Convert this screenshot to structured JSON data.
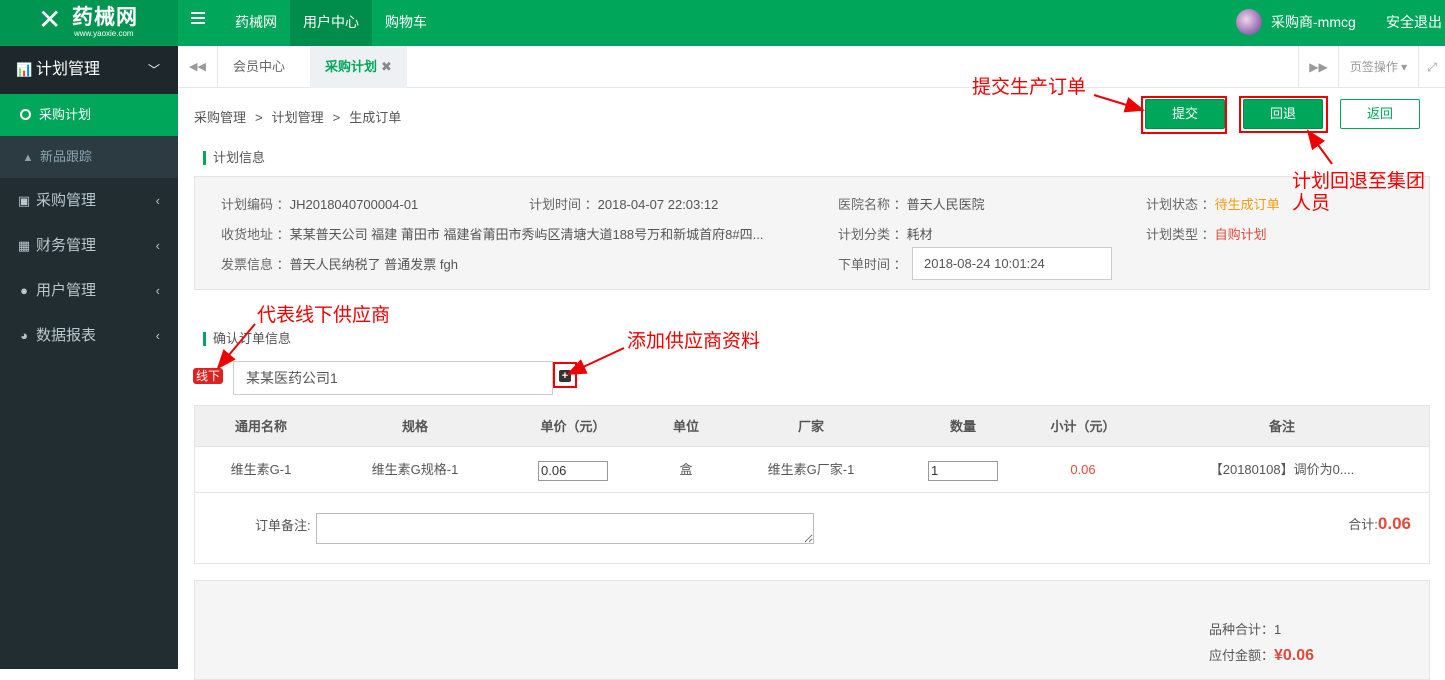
{
  "header": {
    "logo_mark": "✕",
    "logo_text": "药械网",
    "logo_url": "www.yaoxie.com",
    "nav": [
      "药械网",
      "用户中心",
      "购物车"
    ],
    "user_name": "采购商-mmcg",
    "logout": "安全退出"
  },
  "sidebar": {
    "group_title": "计划管理",
    "sub_items": [
      "采购计划",
      "新品跟踪"
    ],
    "items": [
      "采购管理",
      "财务管理",
      "用户管理",
      "数据报表"
    ]
  },
  "tabs": {
    "items": [
      "会员中心",
      "采购计划"
    ],
    "page_ops": "页签操作"
  },
  "breadcrumb": [
    "采购管理",
    "计划管理",
    "生成订单"
  ],
  "breadcrumb_sep": ">",
  "actions": {
    "submit": "提交",
    "rollback": "回退",
    "back": "返回"
  },
  "plan": {
    "section_title": "计划信息",
    "code_label": "计划编码 ：",
    "code": "JH2018040700004-01",
    "time_label": "计划时间 ：",
    "time": "2018-04-07 22:03:12",
    "hospital_label": "医院名称 ：",
    "hospital": "普天人民医院",
    "status_label": "计划状态 ：",
    "status": "待生成订单",
    "address_label": "收货地址 ：",
    "address": "某某普天公司 福建 莆田市 福建省莆田市秀屿区清塘大道188号万和新城首府8#四...",
    "category_label": "计划分类 ：",
    "category": "耗材",
    "type_label": "计划类型 ：",
    "type": "自购计划",
    "invoice_label": "发票信息 ：",
    "invoice": "普天人民纳税了 普通发票 fgh",
    "order_time_label": "下单时间 ：",
    "order_time": "2018-08-24 10:01:24"
  },
  "order": {
    "section_title": "确认订单信息",
    "offline_badge": "线下",
    "supplier": "某某医药公司1",
    "add_icon": "+",
    "headers": [
      "通用名称",
      "规格",
      "单价（元）",
      "单位",
      "厂家",
      "数量",
      "小计（元）",
      "备注"
    ],
    "rows": [
      {
        "name": "维生素G-1",
        "spec": "维生素G规格-1",
        "price": "0.06",
        "unit": "盒",
        "maker": "维生素G厂家-1",
        "qty": "1",
        "subtotal": "0.06",
        "remark": "【20180108】调价为0...."
      }
    ],
    "note_label": "订单备注:",
    "total_label": "合计:",
    "total": "0.06"
  },
  "summary": {
    "kinds_label": "品种合计：",
    "kinds": "1",
    "pay_label": "应付金额：",
    "pay": "¥0.06"
  },
  "annotations": {
    "submit_note": "提交生产订单",
    "rollback_note_1": "计划回退至集团",
    "rollback_note_2": "人员",
    "offline_note": "代表线下供应商",
    "add_supplier_note": "添加供应商资料"
  },
  "colors": {
    "brand": "#00a65a",
    "sidebar": "#222d32",
    "annotation": "#e00000",
    "price": "#dd4b39"
  }
}
